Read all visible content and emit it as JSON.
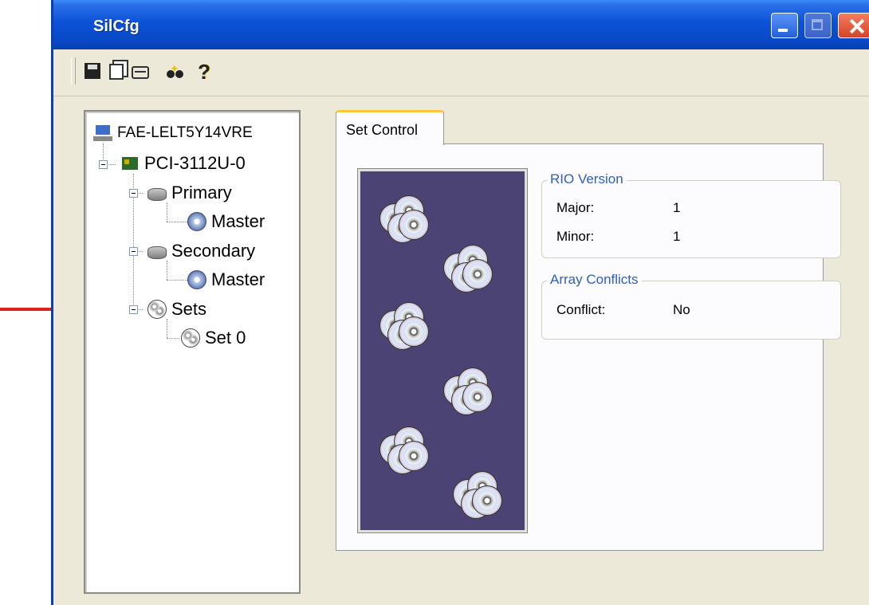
{
  "window": {
    "title": "SilCfg"
  },
  "toolbar": {
    "icons": [
      "save-icon",
      "copy-icon",
      "print-icon",
      "find-icon",
      "help-icon"
    ]
  },
  "tree": {
    "computer": "FAE-LELT5Y14VRE",
    "controller": "PCI-3112U-0",
    "primary": "Primary",
    "primary_master": "Master",
    "secondary": "Secondary",
    "secondary_master": "Master",
    "sets": "Sets",
    "set0": "Set 0"
  },
  "tab": {
    "label": "Set Control"
  },
  "rio_version": {
    "title": "RIO Version",
    "major_label": "Major:",
    "major_value": "1",
    "minor_label": "Minor:",
    "minor_value": "1"
  },
  "array_conflicts": {
    "title": "Array Conflicts",
    "conflict_label": "Conflict:",
    "conflict_value": "No"
  },
  "colors": {
    "titlebar": "#0b52d8",
    "art_background": "#4b4374",
    "annotation_arrow": "#e0201a",
    "group_title": "#2f5fc0"
  }
}
